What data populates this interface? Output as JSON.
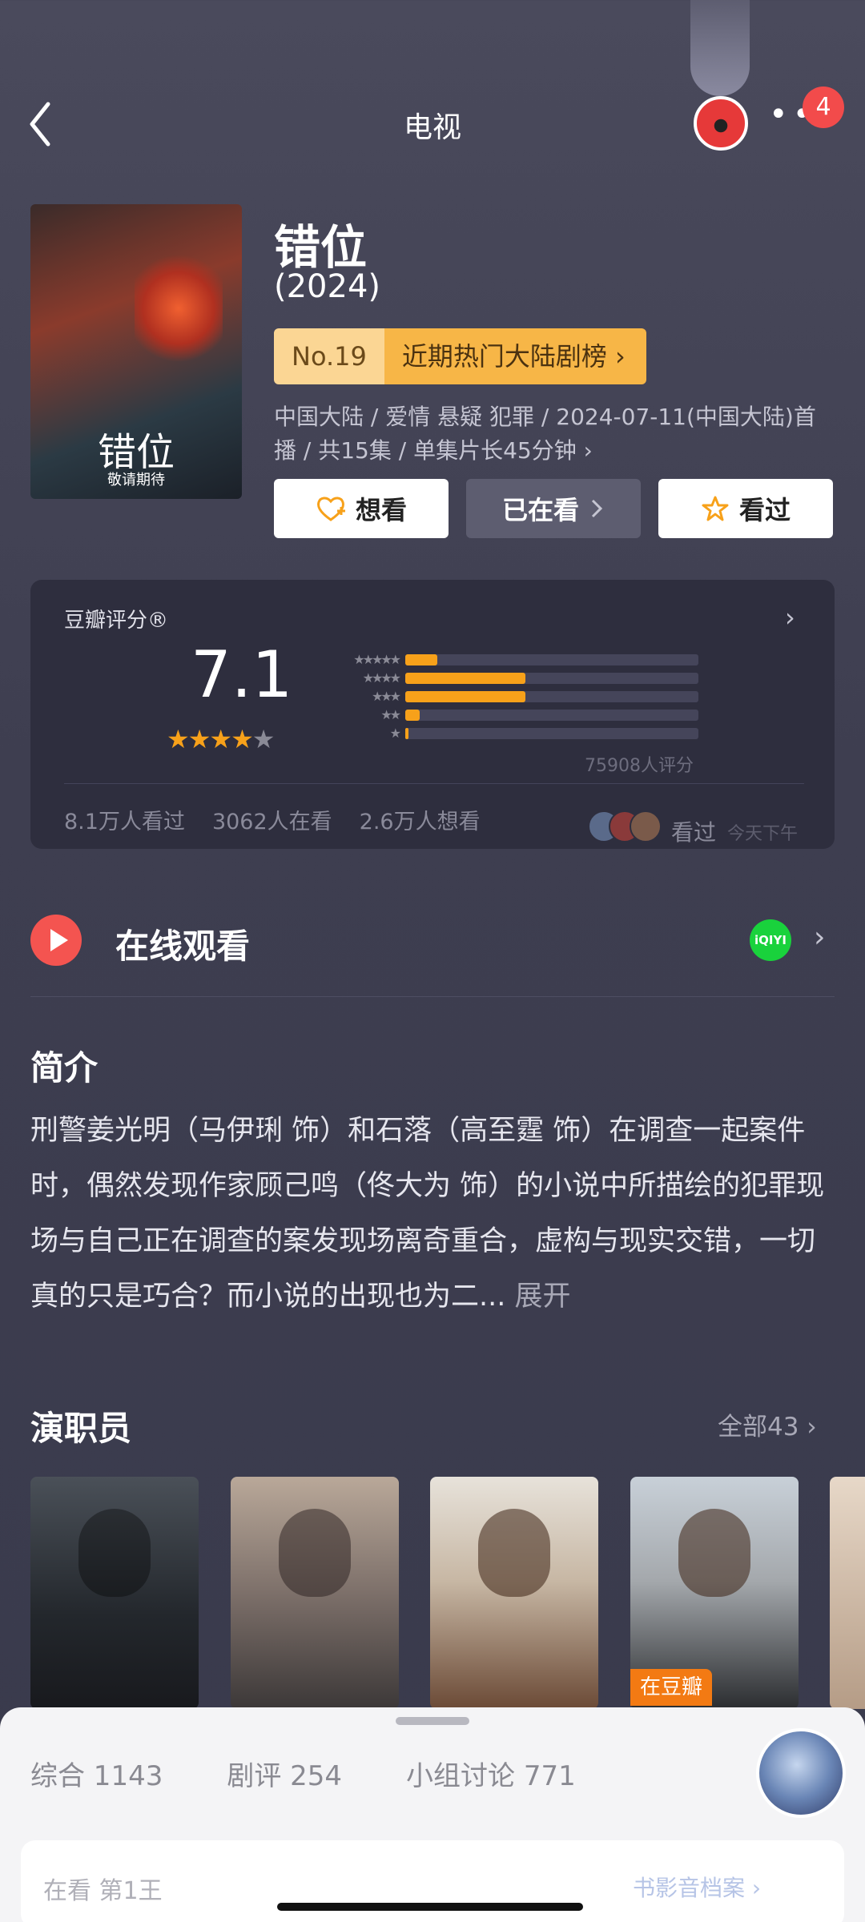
{
  "header": {
    "title": "电视",
    "badge_count": "4",
    "more_label": "••"
  },
  "poster": {
    "title": "错位",
    "subtitle": "敬请期待"
  },
  "movie": {
    "title": "错位",
    "year": "(2024)",
    "rank_no": "No.19",
    "rank_label": "近期热门大陆剧榜 ›",
    "meta": "中国大陆 / 爱情 悬疑 犯罪 / 2024-07-11(中国大陆)首播 / 共15集 / 单集片长45分钟 ›"
  },
  "actions": {
    "want": "想看",
    "watching": "已在看",
    "watched": "看过"
  },
  "rating": {
    "label": "豆瓣评分®",
    "score": "7.1",
    "stars_value": 3.5,
    "distribution": [
      0.11,
      0.41,
      0.41,
      0.05,
      0.01
    ],
    "count": "75908人评分",
    "stats": [
      "8.1万人看过",
      "3062人在看",
      "2.6万人想看"
    ],
    "seen_label": "看过",
    "seen_time": "今天下午"
  },
  "online": {
    "label": "在线观看",
    "provider": "iQIYI"
  },
  "intro": {
    "heading": "简介",
    "text": "刑警姜光明（马伊琍 饰）和石落（高至霆 饰）在调查一起案件时，偶然发现作家顾己鸣（佟大为 饰）的小说中所描绘的犯罪现场与自己正在调查的案发现场离奇重合，虚构与现实交错，一切真的只是巧合？而小说的出现也为二...",
    "more": "展开"
  },
  "cast": {
    "heading": "演职员",
    "all_label": "全部43 ›",
    "tag": "在豆瓣"
  },
  "sheet": {
    "tabs": [
      "综合 1143",
      "剧评 254",
      "小组讨论 771"
    ],
    "card_text": "在看 第1王",
    "card_link": "书影音档案 ›"
  },
  "colors": {
    "accent": "#f7a11a",
    "rank_bg": "#f7b647",
    "play": "#f45450",
    "iqiyi": "#19d23c",
    "tag": "#f37a13"
  }
}
